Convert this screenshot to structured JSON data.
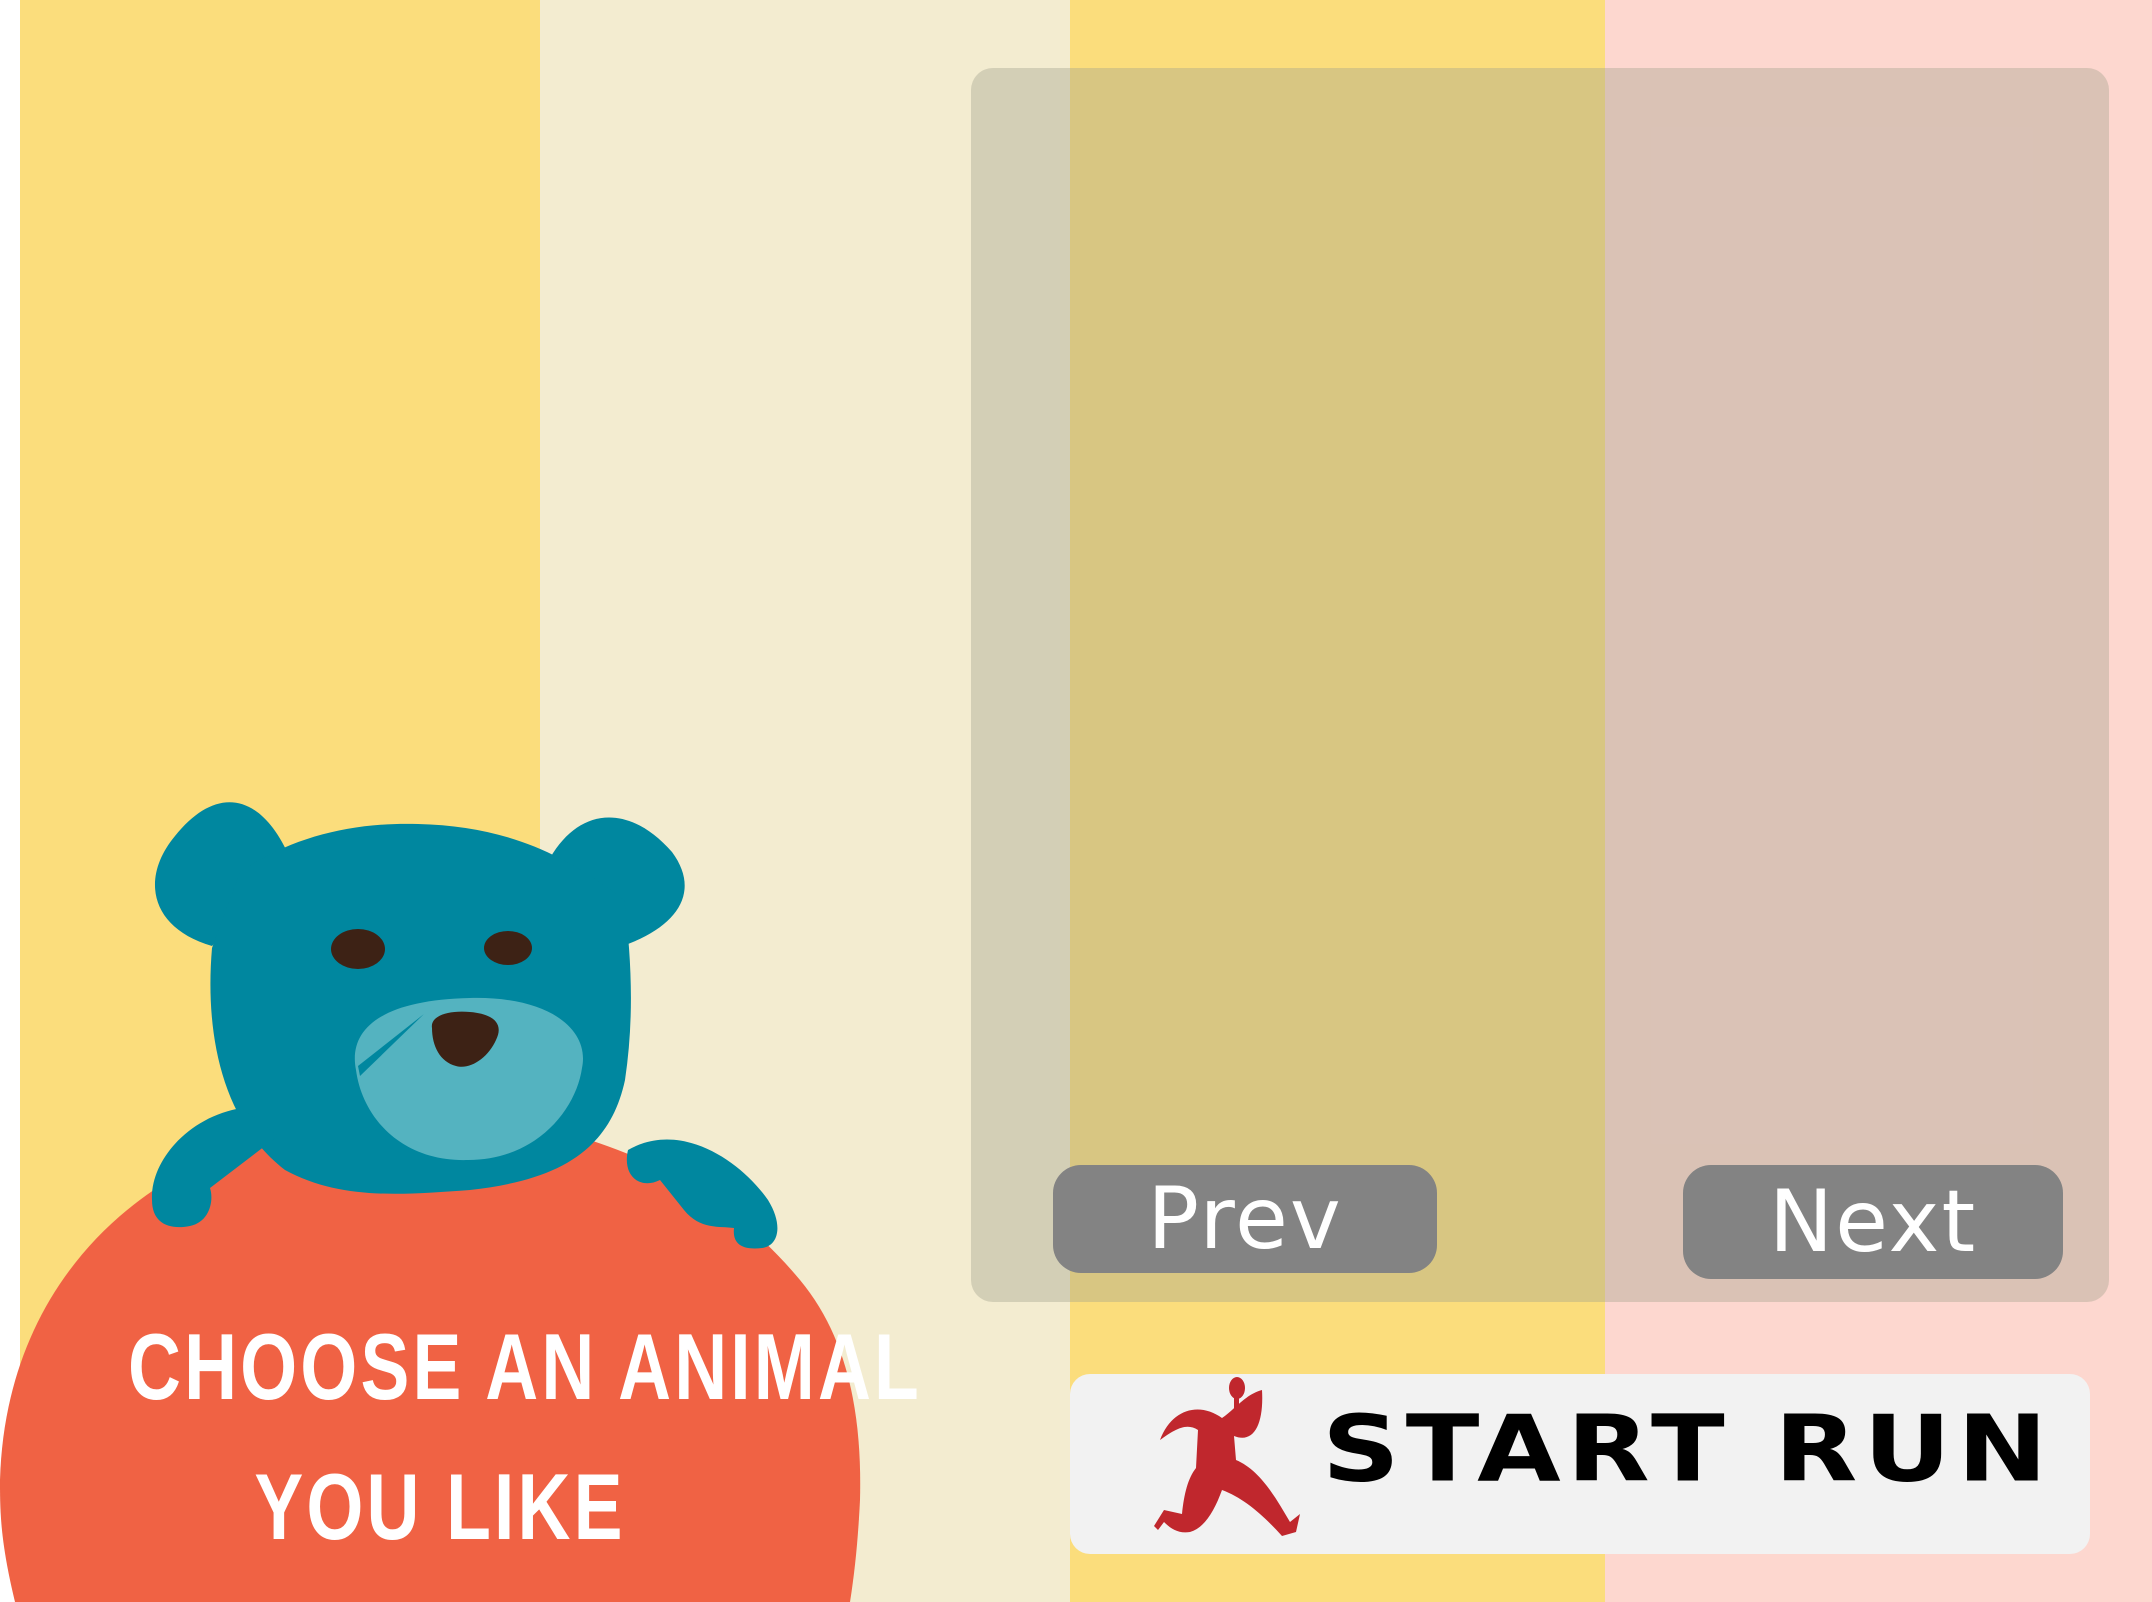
{
  "background": {
    "stripe_colors": [
      "#fbdd7c",
      "#f3ecd0",
      "#fbdd7c",
      "#fdd7cf"
    ]
  },
  "animal_selector": {
    "prev_label": "Prev",
    "next_label": "Next"
  },
  "start_button": {
    "label": "START RUN",
    "icon": "runner-icon"
  },
  "prompt": {
    "line1": "CHOOSE AN ANIMAL",
    "line2": "YOU LIKE"
  },
  "mascot": {
    "animal": "bear",
    "fur_color": "#00879f",
    "muzzle_color": "#54b3c0",
    "sign_color": "#f06244"
  }
}
